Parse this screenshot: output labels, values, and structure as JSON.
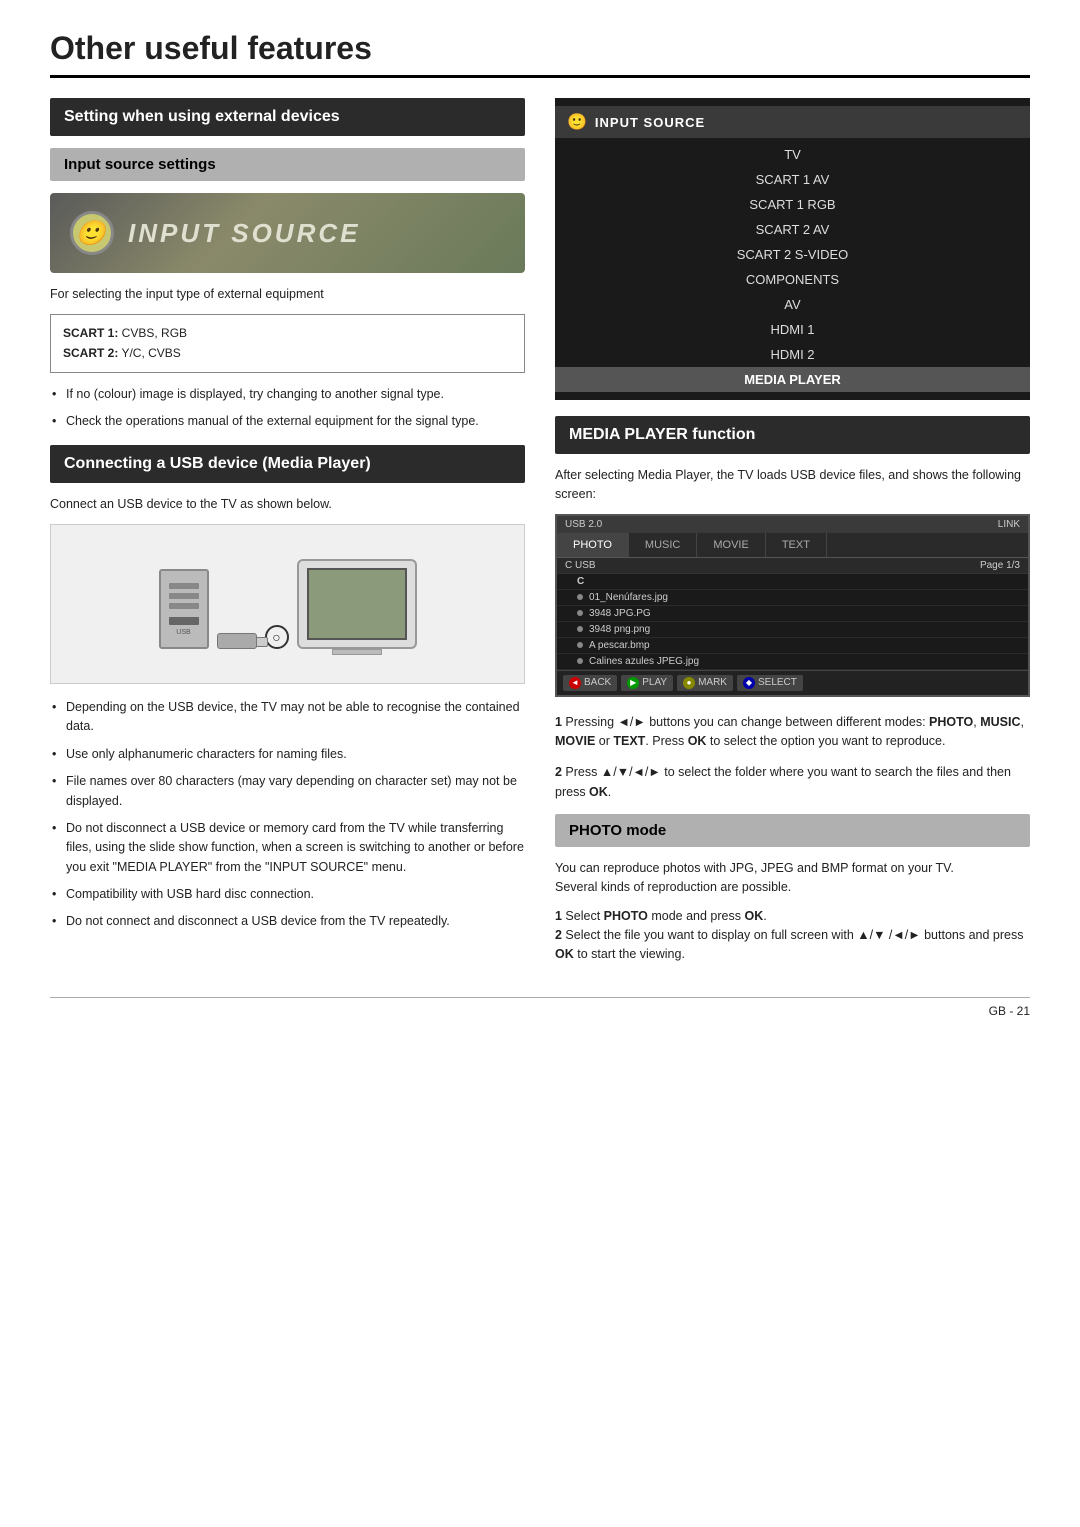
{
  "page": {
    "title": "Other useful features",
    "page_number": "GB - 21"
  },
  "left_col": {
    "section1_header": "Setting when using external devices",
    "section2_header": "Input source settings",
    "input_source_banner_text": "INPUT SOURCE",
    "input_source_description": "For selecting the input type of external equipment",
    "scart_info": [
      "SCART 1: CVBS, RGB",
      "SCART 2: Y/C, CVBS"
    ],
    "bullets1": [
      "If no (colour) image is displayed, try changing to another signal type.",
      "Check the operations manual of the external equipment for the signal type."
    ],
    "section3_header": "Connecting a USB device (Media Player)",
    "usb_description": "Connect an USB device to the TV as shown below.",
    "bullets2": [
      "Depending on the USB device, the TV may not be able to recognise the contained data.",
      "Use only alphanumeric characters for naming files.",
      "File names over 80 characters (may vary depending on character set) may not be displayed.",
      "Do not disconnect a USB device or memory card from the TV while transferring files, using the slide show function, when a screen is switching to another or before you exit \"MEDIA PLAYER\" from the \"INPUT SOURCE\" menu.",
      "Compatibility with USB hard disc connection.",
      "Do not connect and disconnect a USB device from the TV repeatedly."
    ]
  },
  "right_col": {
    "input_source_menu": {
      "header": "INPUT SOURCE",
      "items": [
        {
          "label": "TV",
          "highlighted": false
        },
        {
          "label": "SCART 1 AV",
          "highlighted": false
        },
        {
          "label": "SCART 1 RGB",
          "highlighted": false
        },
        {
          "label": "SCART 2 AV",
          "highlighted": false
        },
        {
          "label": "SCART 2 S-VIDEO",
          "highlighted": false
        },
        {
          "label": "COMPONENTS",
          "highlighted": false
        },
        {
          "label": "AV",
          "highlighted": false
        },
        {
          "label": "HDMI 1",
          "highlighted": false
        },
        {
          "label": "HDMI 2",
          "highlighted": false
        },
        {
          "label": "MEDIA PLAYER",
          "highlighted": true
        }
      ]
    },
    "media_player_section": {
      "header": "MEDIA PLAYER function",
      "description": "After selecting Media Player, the TV loads USB device files, and shows the following screen:",
      "ui": {
        "topbar_left": "USB 2.0",
        "topbar_right": "LINK",
        "tabs": [
          "PHOTO",
          "MUSIC",
          "MOVIE",
          "TEXT"
        ],
        "active_tab": "PHOTO",
        "breadcrumb": "C USB",
        "page_info": "Page 1/3",
        "folder": "C",
        "files": [
          "01_Nenúfares.jpg",
          "3948 JPG.PG",
          "3948 png.png",
          "A pescar.bmp",
          "Calines azules JPEG.jpg"
        ],
        "bottom_buttons": [
          {
            "color": "red",
            "label": "BACK"
          },
          {
            "color": "green",
            "label": "PLAY"
          },
          {
            "color": "yellow",
            "label": "MARK"
          },
          {
            "color": "blue",
            "label": "SELECT"
          }
        ]
      },
      "text1_num": "1",
      "text1": "Pressing ◄/► buttons you can change between different modes: PHOTO, MUSIC, MOVIE or TEXT. Press OK to select the option you want to reproduce.",
      "text2_num": "2",
      "text2": "Press ▲/▼/◄/► to select the folder where you want to search the files and then press OK."
    },
    "photo_mode": {
      "header": "PHOTO mode",
      "description": "You can reproduce photos with JPG, JPEG and BMP format on your TV.\nSeveral kinds of reproduction are possible.",
      "steps": [
        "Select PHOTO mode and press OK.",
        "Select the file you want to display on full screen with ▲/▼ /◄/► buttons and press OK to start the viewing."
      ]
    }
  }
}
